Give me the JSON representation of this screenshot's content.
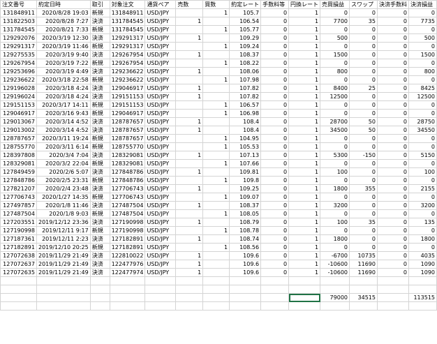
{
  "headers": [
    "注文番号",
    "約定日時",
    "取引",
    "対象注文",
    "通貨ペア",
    "売数",
    "買数",
    "約定レート",
    "手数料等",
    "円換レート",
    "売買損益",
    "スワップ",
    "決済手数料",
    "決済損益"
  ],
  "rows": [
    [
      "131848911",
      "2020/8/28 19:03",
      "新規",
      "131848911",
      "USD/JPY",
      "",
      "1",
      "105.7",
      "0",
      "1",
      "0",
      "0",
      "0",
      "0"
    ],
    [
      "131822503",
      "2020/8/28 7:27",
      "決済",
      "131784545",
      "USD/JPY",
      "1",
      "",
      "106.54",
      "0",
      "1",
      "7700",
      "35",
      "0",
      "7735"
    ],
    [
      "131784545",
      "2020/8/21 7:33",
      "新規",
      "131784545",
      "USD/JPY",
      "",
      "1",
      "105.77",
      "0",
      "1",
      "0",
      "0",
      "0",
      "0"
    ],
    [
      "129292076",
      "2020/3/19 12:30",
      "決済",
      "129291317",
      "USD/JPY",
      "1",
      "",
      "109.29",
      "0",
      "1",
      "500",
      "0",
      "0",
      "500"
    ],
    [
      "129291317",
      "2020/3/19 11:46",
      "新規",
      "129291317",
      "USD/JPY",
      "",
      "1",
      "109.24",
      "0",
      "1",
      "0",
      "0",
      "0",
      "0"
    ],
    [
      "129275535",
      "2020/3/19 9:40",
      "決済",
      "129267954",
      "USD/JPY",
      "1",
      "",
      "108.37",
      "0",
      "1",
      "1500",
      "0",
      "0",
      "1500"
    ],
    [
      "129267954",
      "2020/3/19 7:22",
      "新規",
      "129267954",
      "USD/JPY",
      "",
      "1",
      "108.22",
      "0",
      "1",
      "0",
      "0",
      "0",
      "0"
    ],
    [
      "129253696",
      "2020/3/19 4:49",
      "決済",
      "129236622",
      "USD/JPY",
      "1",
      "",
      "108.06",
      "0",
      "1",
      "800",
      "0",
      "0",
      "800"
    ],
    [
      "129236622",
      "2020/3/18 22:58",
      "新規",
      "129236622",
      "USD/JPY",
      "",
      "1",
      "107.98",
      "0",
      "1",
      "0",
      "0",
      "0",
      "0"
    ],
    [
      "129196028",
      "2020/3/18 4:24",
      "決済",
      "129046917",
      "USD/JPY",
      "1",
      "",
      "107.82",
      "0",
      "1",
      "8400",
      "25",
      "0",
      "8425"
    ],
    [
      "129196024",
      "2020/3/18 4:24",
      "決済",
      "129151153",
      "USD/JPY",
      "1",
      "",
      "107.82",
      "0",
      "1",
      "12500",
      "0",
      "0",
      "12500"
    ],
    [
      "129151153",
      "2020/3/17 14:11",
      "新規",
      "129151153",
      "USD/JPY",
      "",
      "1",
      "106.57",
      "0",
      "1",
      "0",
      "0",
      "0",
      "0"
    ],
    [
      "129046917",
      "2020/3/16 9:43",
      "新規",
      "129046917",
      "USD/JPY",
      "",
      "1",
      "106.98",
      "0",
      "1",
      "0",
      "0",
      "0",
      "0"
    ],
    [
      "129013067",
      "2020/3/14 4:52",
      "決済",
      "128787657",
      "USD/JPY",
      "1",
      "",
      "108.4",
      "0",
      "1",
      "28700",
      "50",
      "0",
      "28750"
    ],
    [
      "129013002",
      "2020/3/14 4:52",
      "決済",
      "128787657",
      "USD/JPY",
      "1",
      "",
      "108.4",
      "0",
      "1",
      "34500",
      "50",
      "0",
      "34550"
    ],
    [
      "128787657",
      "2020/3/11 19:24",
      "新規",
      "128787657",
      "USD/JPY",
      "",
      "1",
      "104.95",
      "0",
      "1",
      "0",
      "0",
      "0",
      "0"
    ],
    [
      "128755770",
      "2020/3/11 6:14",
      "新規",
      "128755770",
      "USD/JPY",
      "",
      "1",
      "105.53",
      "0",
      "1",
      "0",
      "0",
      "0",
      "0"
    ],
    [
      "128397808",
      "2020/3/4 7:04",
      "決済",
      "128329081",
      "USD/JPY",
      "1",
      "",
      "107.13",
      "0",
      "1",
      "5300",
      "-150",
      "0",
      "5150"
    ],
    [
      "128329081",
      "2020/3/2 22:04",
      "新規",
      "128329081",
      "USD/JPY",
      "",
      "1",
      "107.66",
      "0",
      "1",
      "0",
      "0",
      "0",
      "0"
    ],
    [
      "127849459",
      "2020/2/6 5:07",
      "決済",
      "127848786",
      "USD/JPY",
      "1",
      "",
      "109.81",
      "0",
      "1",
      "100",
      "0",
      "0",
      "100"
    ],
    [
      "127848786",
      "2020/2/5 23:31",
      "新規",
      "127848786",
      "USD/JPY",
      "",
      "1",
      "109.8",
      "0",
      "1",
      "0",
      "0",
      "0",
      "0"
    ],
    [
      "127821207",
      "2020/2/4 23:48",
      "決済",
      "127706743",
      "USD/JPY",
      "1",
      "",
      "109.25",
      "0",
      "1",
      "1800",
      "355",
      "0",
      "2155"
    ],
    [
      "127706743",
      "2020/1/27 14:35",
      "新規",
      "127706743",
      "USD/JPY",
      "",
      "1",
      "109.07",
      "0",
      "1",
      "0",
      "0",
      "0",
      "0"
    ],
    [
      "127497857",
      "2020/1/8 11:46",
      "決済",
      "127487504",
      "USD/JPY",
      "1",
      "",
      "108.37",
      "0",
      "1",
      "3200",
      "0",
      "0",
      "3200"
    ],
    [
      "127487504",
      "2020/1/8 9:03",
      "新規",
      "127487504",
      "USD/JPY",
      "",
      "1",
      "108.05",
      "0",
      "1",
      "0",
      "0",
      "0",
      "0"
    ],
    [
      "127203551",
      "2019/12/12 23:36",
      "決済",
      "127190998",
      "USD/JPY",
      "1",
      "",
      "108.79",
      "0",
      "1",
      "100",
      "35",
      "0",
      "135"
    ],
    [
      "127190998",
      "2019/12/11 9:17",
      "新規",
      "127190998",
      "USD/JPY",
      "",
      "1",
      "108.78",
      "0",
      "1",
      "0",
      "0",
      "0",
      "0"
    ],
    [
      "127187361",
      "2019/12/11 2:23",
      "決済",
      "127182891",
      "USD/JPY",
      "1",
      "",
      "108.74",
      "0",
      "1",
      "1800",
      "0",
      "0",
      "1800"
    ],
    [
      "127182891",
      "2019/12/10 20:25",
      "新規",
      "127182891",
      "USD/JPY",
      "",
      "1",
      "108.56",
      "0",
      "1",
      "0",
      "0",
      "0",
      "0"
    ],
    [
      "127072638",
      "2019/11/29 21:49",
      "決済",
      "122810022",
      "USD/JPY",
      "1",
      "",
      "109.6",
      "0",
      "1",
      "-6700",
      "10735",
      "0",
      "4035"
    ],
    [
      "127072637",
      "2019/11/29 21:49",
      "決済",
      "122477976",
      "USD/JPY",
      "1",
      "",
      "109.6",
      "0",
      "1",
      "-10600",
      "11690",
      "0",
      "1090"
    ],
    [
      "127072635",
      "2019/11/29 21:49",
      "決済",
      "122477974",
      "USD/JPY",
      "1",
      "",
      "109.6",
      "0",
      "1",
      "-10600",
      "11690",
      "0",
      "1090"
    ],
    [
      "",
      "",
      "",
      "",
      "",
      "",
      "",
      "",
      "",
      "",
      "",
      "",
      "",
      ""
    ],
    [
      "",
      "",
      "",
      "",
      "",
      "",
      "",
      "",
      "",
      "",
      "",
      "",
      "",
      ""
    ],
    [
      "",
      "",
      "",
      "",
      "",
      "",
      "",
      "",
      "",
      "",
      "79000",
      "34515",
      "",
      "113515"
    ],
    [
      "",
      "",
      "",
      "",
      "",
      "",
      "",
      "",
      "",
      "",
      "",
      "",
      "",
      ""
    ]
  ],
  "text_columns": [
    2,
    4
  ]
}
